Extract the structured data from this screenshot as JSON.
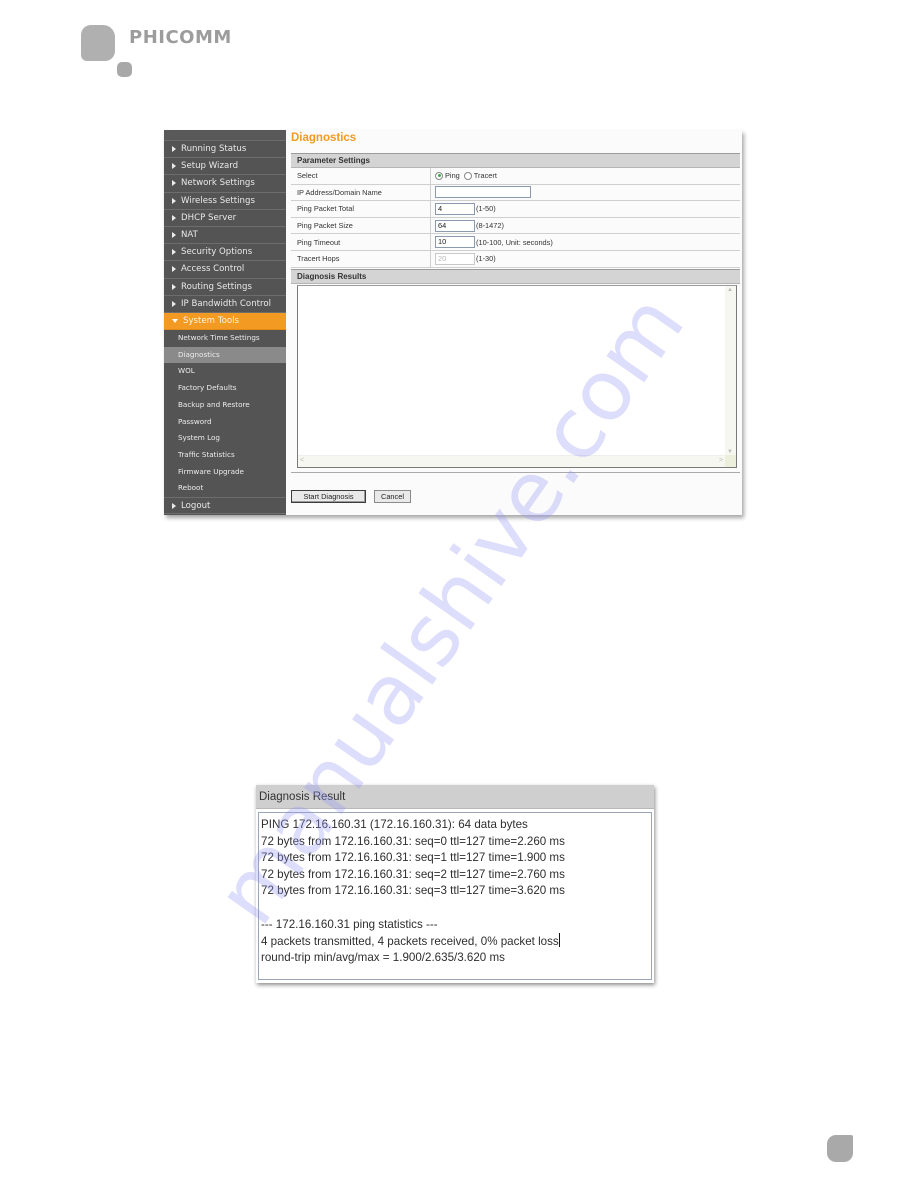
{
  "brand": {
    "name": "PHICOMM"
  },
  "router_ui": {
    "sidebar": {
      "items": [
        {
          "label": "Running Status"
        },
        {
          "label": "Setup Wizard"
        },
        {
          "label": "Network Settings"
        },
        {
          "label": "Wireless Settings"
        },
        {
          "label": "DHCP Server"
        },
        {
          "label": "NAT"
        },
        {
          "label": "Security Options"
        },
        {
          "label": "Access Control"
        },
        {
          "label": "Routing Settings"
        },
        {
          "label": "IP Bandwidth Control"
        },
        {
          "label": "System Tools",
          "expanded": true
        }
      ],
      "sub_items": [
        {
          "label": "Network Time Settings"
        },
        {
          "label": "Diagnostics",
          "selected": true
        },
        {
          "label": "WOL"
        },
        {
          "label": "Factory Defaults"
        },
        {
          "label": "Backup and Restore"
        },
        {
          "label": "Password"
        },
        {
          "label": "System Log"
        },
        {
          "label": "Traffic Statistics"
        },
        {
          "label": "Firmware Upgrade"
        },
        {
          "label": "Reboot"
        }
      ],
      "logout": "Logout"
    },
    "content": {
      "title": "Diagnostics",
      "parameter_header": "Parameter Settings",
      "rows": {
        "select": {
          "label": "Select",
          "options": [
            "Ping",
            "Tracert"
          ],
          "selected": "Ping"
        },
        "ip": {
          "label": "IP Address/Domain Name",
          "value": ""
        },
        "packet_total": {
          "label": "Ping Packet Total",
          "value": "4",
          "hint": "(1-50)"
        },
        "packet_size": {
          "label": "Ping Packet Size",
          "value": "64",
          "hint": "(8-1472)"
        },
        "timeout": {
          "label": "Ping Timeout",
          "value": "10",
          "hint": "(10-100, Unit: seconds)"
        },
        "hops": {
          "label": "Tracert Hops",
          "value": "20",
          "hint": "(1-30)",
          "disabled": true
        }
      },
      "results_header": "Diagnosis Results",
      "results_text": "",
      "buttons": {
        "start": "Start Diagnosis",
        "cancel": "Cancel"
      }
    }
  },
  "diagnosis_result": {
    "header": "Diagnosis Result",
    "lines": [
      "PING 172.16.160.31 (172.16.160.31): 64 data bytes",
      "72 bytes from 172.16.160.31: seq=0 ttl=127 time=2.260 ms",
      "72 bytes from 172.16.160.31: seq=1 ttl=127 time=1.900 ms",
      "72 bytes from 172.16.160.31: seq=2 ttl=127 time=2.760 ms",
      "72 bytes from 172.16.160.31: seq=3 ttl=127 time=3.620 ms",
      "",
      "--- 172.16.160.31 ping statistics ---",
      "4 packets transmitted, 4 packets received, 0% packet loss",
      "round-trip min/avg/max = 1.900/2.635/3.620 ms"
    ]
  },
  "watermark": "manualshive.com",
  "colors": {
    "accent": "#f39a22",
    "sidebar": "#545454",
    "selected_sub": "#8a8a8a",
    "watermark": "#9696f5"
  }
}
